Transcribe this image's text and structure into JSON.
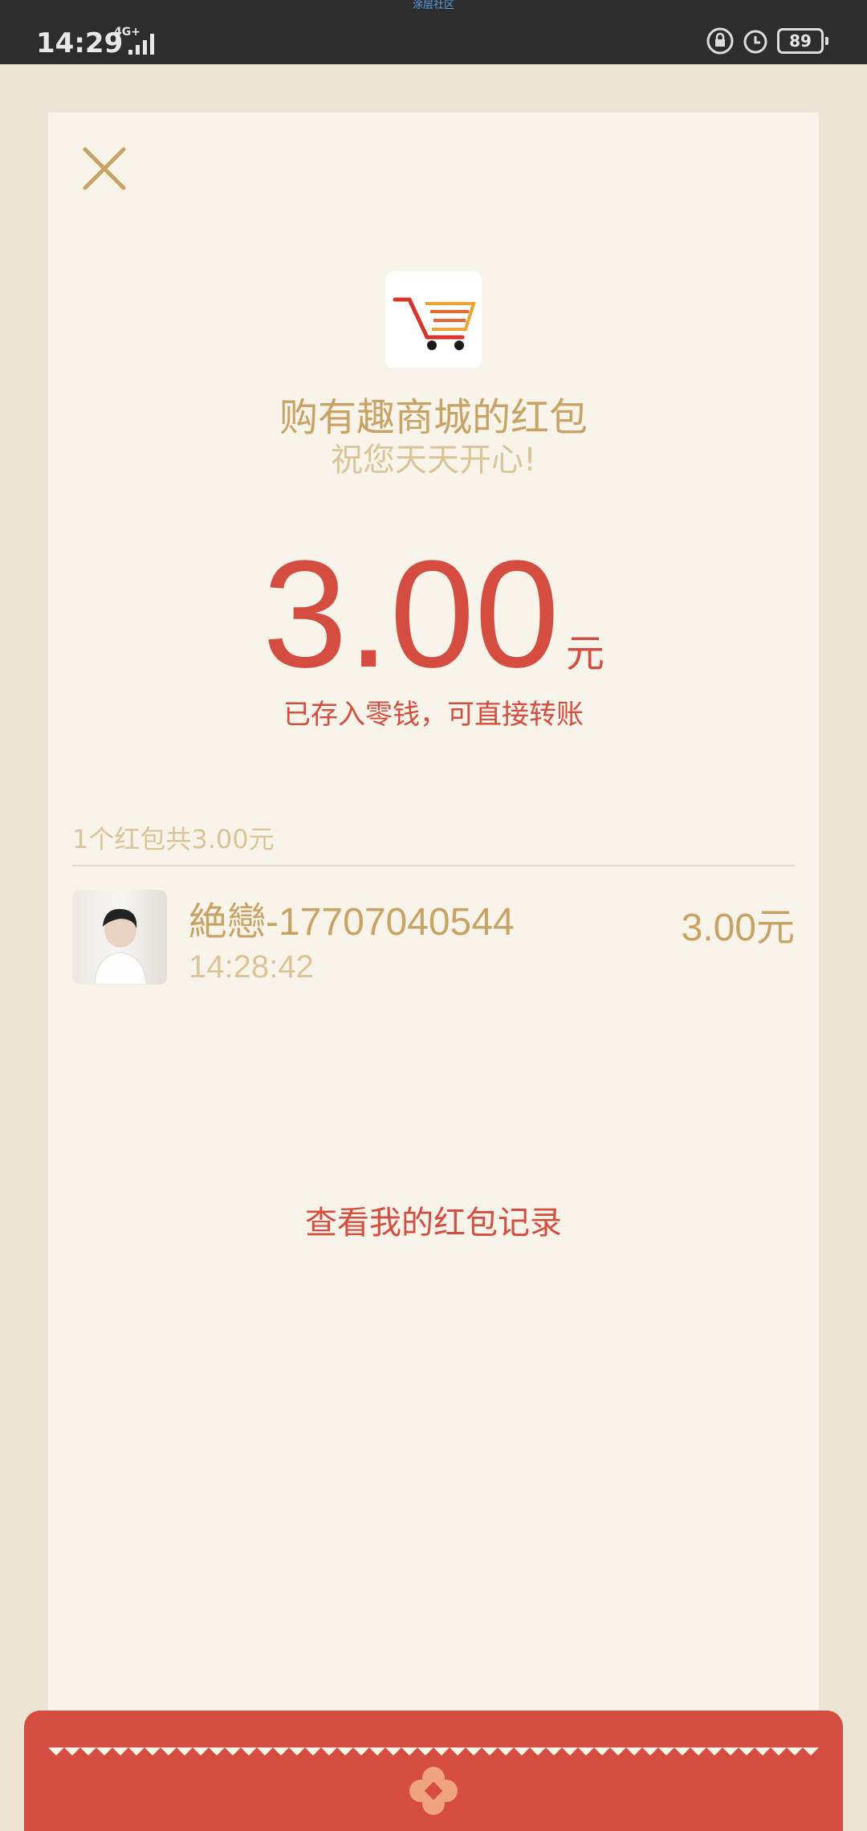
{
  "status_bar": {
    "top_label": "涂层社区",
    "time": "14:29",
    "network": "4G+",
    "battery": "89"
  },
  "red_packet": {
    "shop_title": "购有趣商城的红包",
    "blessing": "祝您天天开心!",
    "amount": "3.00",
    "amount_unit": "元",
    "saved_note": "已存入零钱，可直接转账",
    "summary": "1个红包共3.00元",
    "receiver": {
      "name": "絶戀-17707040544",
      "time": "14:28:42",
      "amount": "3.00元"
    },
    "record_link": "查看我的红包记录"
  },
  "colors": {
    "accent_red": "#d54c40",
    "gold": "#c9a266",
    "card_bg": "#f9f4e9"
  },
  "icons": [
    "close-icon",
    "shopping-cart-logo",
    "lock-icon",
    "alarm-icon",
    "flower-badge-icon"
  ]
}
